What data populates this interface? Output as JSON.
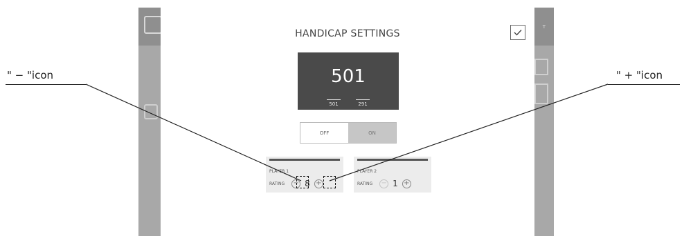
{
  "callouts": {
    "minus": "\" − \"icon",
    "plus": "\" + \"icon"
  },
  "background_app": {
    "right_header_text": "T"
  },
  "modal": {
    "title": "HANDICAP SETTINGS",
    "confirm_icon": "check-icon",
    "score": {
      "main": "501",
      "player1": "501",
      "player2": "291"
    },
    "toggle": {
      "off": "OFF",
      "on": "ON",
      "selected": "ON"
    },
    "players": [
      {
        "name": "PLAYER 1",
        "rating_label": "RATING",
        "rating": "8"
      },
      {
        "name": "PLAYER 2",
        "rating_label": "RATING",
        "rating": "1"
      }
    ]
  },
  "colors": {
    "score_panel": "#4a4a4a",
    "dim_overlay": "#a8a8a8",
    "toggle_on": "#c6c6c6"
  }
}
